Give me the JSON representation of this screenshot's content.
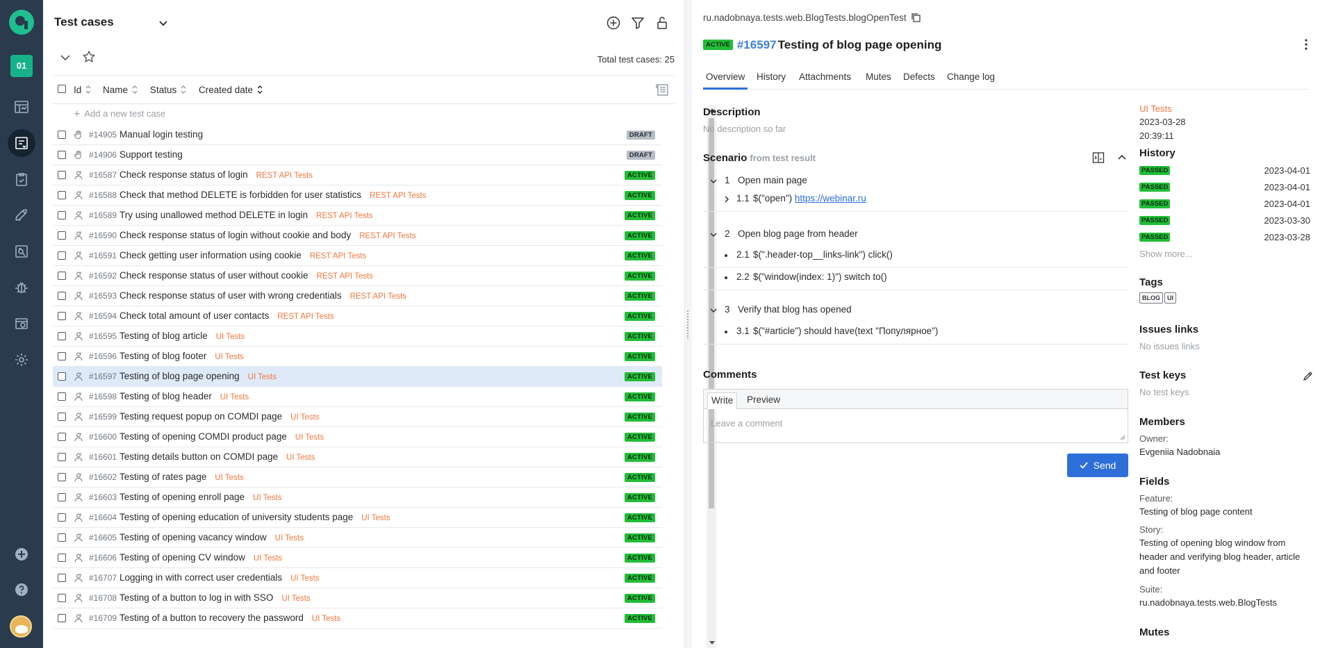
{
  "sidebar": {
    "project_badge": "01",
    "items": [
      {
        "name": "dashboard-icon"
      },
      {
        "name": "test-cases-icon",
        "active": true
      },
      {
        "name": "test-plans-icon"
      },
      {
        "name": "launches-icon"
      },
      {
        "name": "analytics-icon"
      },
      {
        "name": "defects-icon"
      },
      {
        "name": "jobs-icon"
      },
      {
        "name": "settings-icon"
      },
      {
        "name": "add-icon"
      },
      {
        "name": "help-icon"
      }
    ]
  },
  "left": {
    "title": "Test cases",
    "total": "Total test cases: 25",
    "columns": [
      "Id",
      "Name",
      "Status",
      "Created date"
    ],
    "add_case": "Add a new test case",
    "rows": [
      {
        "id": "#14905",
        "name": "Manual login testing",
        "layer": "",
        "status": "DRAFT",
        "type": "manual"
      },
      {
        "id": "#14906",
        "name": "Support testing",
        "layer": "",
        "status": "DRAFT",
        "type": "manual"
      },
      {
        "id": "#16587",
        "name": "Check response status of login",
        "layer": "REST API Tests",
        "status": "ACTIVE",
        "type": "auto"
      },
      {
        "id": "#16588",
        "name": "Check that method DELETE is forbidden for user statistics",
        "layer": "REST API Tests",
        "status": "ACTIVE",
        "type": "auto"
      },
      {
        "id": "#16589",
        "name": "Try using unallowed method DELETE in login",
        "layer": "REST API Tests",
        "status": "ACTIVE",
        "type": "auto"
      },
      {
        "id": "#16590",
        "name": "Check response status of login without cookie and body",
        "layer": "REST API Tests",
        "status": "ACTIVE",
        "type": "auto"
      },
      {
        "id": "#16591",
        "name": "Check getting user information using cookie",
        "layer": "REST API Tests",
        "status": "ACTIVE",
        "type": "auto"
      },
      {
        "id": "#16592",
        "name": "Check response status of user without cookie",
        "layer": "REST API Tests",
        "status": "ACTIVE",
        "type": "auto"
      },
      {
        "id": "#16593",
        "name": "Check response status of user with wrong credentials",
        "layer": "REST API Tests",
        "status": "ACTIVE",
        "type": "auto"
      },
      {
        "id": "#16594",
        "name": "Check total amount of user contacts",
        "layer": "REST API Tests",
        "status": "ACTIVE",
        "type": "auto"
      },
      {
        "id": "#16595",
        "name": "Testing of blog article",
        "layer": "UI Tests",
        "status": "ACTIVE",
        "type": "auto"
      },
      {
        "id": "#16596",
        "name": "Testing of blog footer",
        "layer": "UI Tests",
        "status": "ACTIVE",
        "type": "auto"
      },
      {
        "id": "#16597",
        "name": "Testing of blog page opening",
        "layer": "UI Tests",
        "status": "ACTIVE",
        "type": "auto",
        "selected": true
      },
      {
        "id": "#16598",
        "name": "Testing of blog header",
        "layer": "UI Tests",
        "status": "ACTIVE",
        "type": "auto"
      },
      {
        "id": "#16599",
        "name": "Testing request popup on COMDI page",
        "layer": "UI Tests",
        "status": "ACTIVE",
        "type": "auto"
      },
      {
        "id": "#16600",
        "name": "Testing of opening COMDI product page",
        "layer": "UI Tests",
        "status": "ACTIVE",
        "type": "auto"
      },
      {
        "id": "#16601",
        "name": "Testing details button on COMDI page",
        "layer": "UI Tests",
        "status": "ACTIVE",
        "type": "auto"
      },
      {
        "id": "#16602",
        "name": "Testing of rates page",
        "layer": "UI Tests",
        "status": "ACTIVE",
        "type": "auto"
      },
      {
        "id": "#16603",
        "name": "Testing of opening enroll page",
        "layer": "UI Tests",
        "status": "ACTIVE",
        "type": "auto"
      },
      {
        "id": "#16604",
        "name": "Testing of opening education of university students page",
        "layer": "UI Tests",
        "status": "ACTIVE",
        "type": "auto"
      },
      {
        "id": "#16605",
        "name": "Testing of opening vacancy window",
        "layer": "UI Tests",
        "status": "ACTIVE",
        "type": "auto"
      },
      {
        "id": "#16606",
        "name": "Testing of opening CV window",
        "layer": "UI Tests",
        "status": "ACTIVE",
        "type": "auto"
      },
      {
        "id": "#16707",
        "name": "Logging in with correct user credentials",
        "layer": "UI Tests",
        "status": "ACTIVE",
        "type": "auto"
      },
      {
        "id": "#16708",
        "name": "Testing of a button to log in with SSO",
        "layer": "UI Tests",
        "status": "ACTIVE",
        "type": "auto"
      },
      {
        "id": "#16709",
        "name": "Testing of a button to recovery the password",
        "layer": "UI Tests",
        "status": "ACTIVE",
        "type": "auto"
      }
    ]
  },
  "detail": {
    "full_name": "ru.nadobnaya.tests.web.BlogTests.blogOpenTest",
    "status": "ACTIVE",
    "id": "#16597",
    "name": "Testing of blog page opening",
    "tabs": [
      "Overview",
      "History",
      "Attachments",
      "Mutes",
      "Defects",
      "Change log"
    ],
    "description_title": "Description",
    "description": "No description so far",
    "scenario_title": "Scenario",
    "scenario_sub": "from test result",
    "steps": [
      {
        "num": "1",
        "text": "Open main page"
      },
      {
        "num": "1.1",
        "text": "$(\"open\")",
        "link": "https://webinar.ru"
      },
      {
        "num": "2",
        "text": "Open blog page from header"
      },
      {
        "num": "2.1",
        "text": "$(\".header-top__links-link\") click()"
      },
      {
        "num": "2.2",
        "text": "$(\"window(index: 1)\") switch to()"
      },
      {
        "num": "3",
        "text": "Verify that blog has opened"
      },
      {
        "num": "3.1",
        "text": "$(\"#article\") should have(text \"Популярное\")"
      }
    ],
    "comments_title": "Comments",
    "comment_tabs": [
      "Write",
      "Preview"
    ],
    "comment_placeholder": "Leave a comment",
    "send_label": "Send"
  },
  "meta": {
    "layer": "UI Tests",
    "created_date": "2023-03-28",
    "created_time": "20:39:11",
    "history_title": "History",
    "history": [
      {
        "status": "PASSED",
        "date": "2023-04-01"
      },
      {
        "status": "PASSED",
        "date": "2023-04-01"
      },
      {
        "status": "PASSED",
        "date": "2023-04-01"
      },
      {
        "status": "PASSED",
        "date": "2023-03-30"
      },
      {
        "status": "PASSED",
        "date": "2023-03-28"
      }
    ],
    "show_more": "Show more...",
    "tags_title": "Tags",
    "tags": [
      "BLOG",
      "UI"
    ],
    "issues_title": "Issues links",
    "issues_empty": "No issues links",
    "keys_title": "Test keys",
    "keys_empty": "No test keys",
    "members_title": "Members",
    "owner_label": "Owner:",
    "owner": "Evgeniia Nadobnaia",
    "fields_title": "Fields",
    "feature_label": "Feature:",
    "feature": "Testing of blog page content",
    "story_label": "Story:",
    "story": "Testing of opening blog window from header and verifying blog header, article and footer",
    "suite_label": "Suite:",
    "suite": "ru.nadobnaya.tests.web.BlogTests",
    "mutes_title": "Mutes"
  },
  "colors": {
    "sidebar": "#2a3b4d",
    "accent": "#2d6ed9",
    "active_badge": "#22bd37",
    "layer_orange": "#f0763a"
  }
}
